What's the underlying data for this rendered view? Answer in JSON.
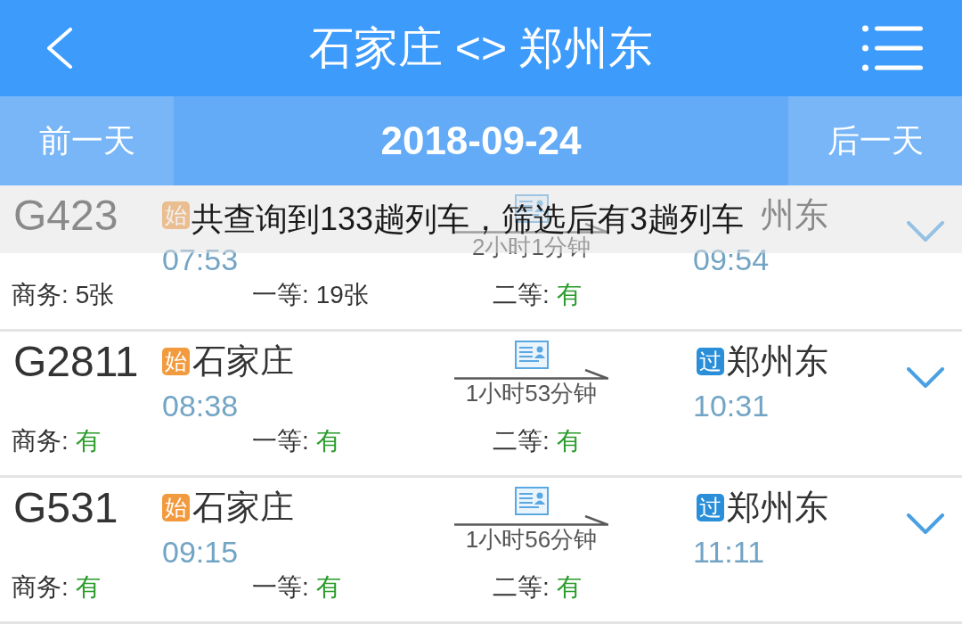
{
  "header": {
    "title": "石家庄 <> 郑州东"
  },
  "date_bar": {
    "previous": "前一天",
    "date": "2018-09-24",
    "next": "后一天"
  },
  "toast": {
    "text": "共查询到133趟列车，筛选后有3趟列车"
  },
  "trains": [
    {
      "number": "G423",
      "from": {
        "badge": {
          "text": "始",
          "kind": "start"
        }
      },
      "departure": "07:53",
      "duration": "2小时1分钟",
      "to": {
        "name": "州东"
      },
      "arrival": "09:54",
      "seats": [
        {
          "label": "商务:",
          "value": "5张",
          "kind": "count"
        },
        {
          "label": "一等:",
          "value": "19张",
          "kind": "count"
        },
        {
          "label": "二等:",
          "value": "有",
          "kind": "plenty"
        }
      ]
    },
    {
      "number": "G2811",
      "from": {
        "badge": {
          "text": "始",
          "kind": "start"
        },
        "name": "石家庄"
      },
      "departure": "08:38",
      "duration": "1小时53分钟",
      "to": {
        "badge": {
          "text": "过",
          "kind": "pass"
        },
        "name": "郑州东"
      },
      "arrival": "10:31",
      "seats": [
        {
          "label": "商务:",
          "value": "有",
          "kind": "plenty"
        },
        {
          "label": "一等:",
          "value": "有",
          "kind": "plenty"
        },
        {
          "label": "二等:",
          "value": "有",
          "kind": "plenty"
        }
      ]
    },
    {
      "number": "G531",
      "from": {
        "badge": {
          "text": "始",
          "kind": "start"
        },
        "name": "石家庄"
      },
      "departure": "09:15",
      "duration": "1小时56分钟",
      "to": {
        "badge": {
          "text": "过",
          "kind": "pass"
        },
        "name": "郑州东"
      },
      "arrival": "11:11",
      "seats": [
        {
          "label": "商务:",
          "value": "有",
          "kind": "plenty"
        },
        {
          "label": "一等:",
          "value": "有",
          "kind": "plenty"
        },
        {
          "label": "二等:",
          "value": "有",
          "kind": "plenty"
        }
      ]
    }
  ]
}
